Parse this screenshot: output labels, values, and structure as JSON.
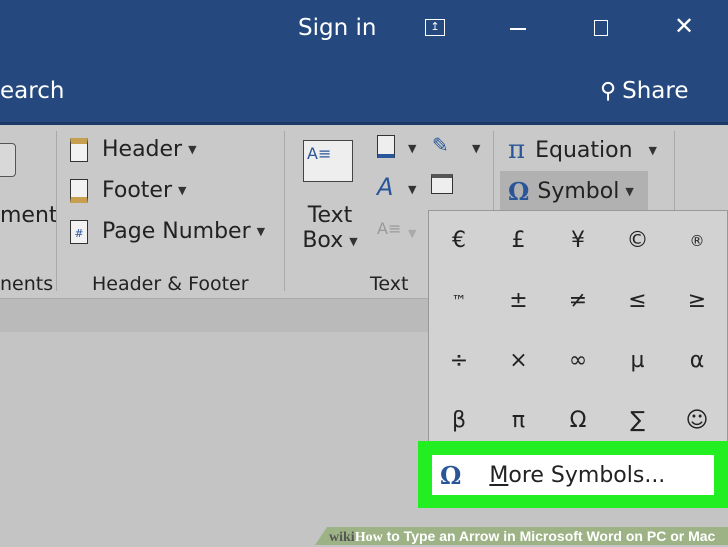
{
  "titlebar": {
    "sign_in": "Sign in",
    "search_partial": "earch",
    "share": "Share"
  },
  "ribbon": {
    "comments_partial": "ment",
    "comments_group_partial": "nents",
    "header": "Header",
    "footer": "Footer",
    "page_number": "Page Number",
    "header_footer_group": "Header & Footer",
    "text_box_line1": "Text",
    "text_box_line2": "Box",
    "text_group": "Text",
    "equation": "Equation",
    "symbol": "Symbol"
  },
  "symbols": [
    "€",
    "£",
    "¥",
    "©",
    "®",
    "™",
    "±",
    "≠",
    "≤",
    "≥",
    "÷",
    "×",
    "∞",
    "µ",
    "α",
    "β",
    "π",
    "Ω",
    "∑",
    "☺"
  ],
  "more_symbols": {
    "icon": "Ω",
    "underlined": "M",
    "rest": "ore Symbols..."
  },
  "footer": {
    "wiki": "wiki",
    "how": "How",
    "title": " to Type an Arrow in Microsoft Word on PC or Mac"
  },
  "colors": {
    "titlebar": "#25497e",
    "highlight": "#22ee22",
    "accent": "#2a5699"
  }
}
